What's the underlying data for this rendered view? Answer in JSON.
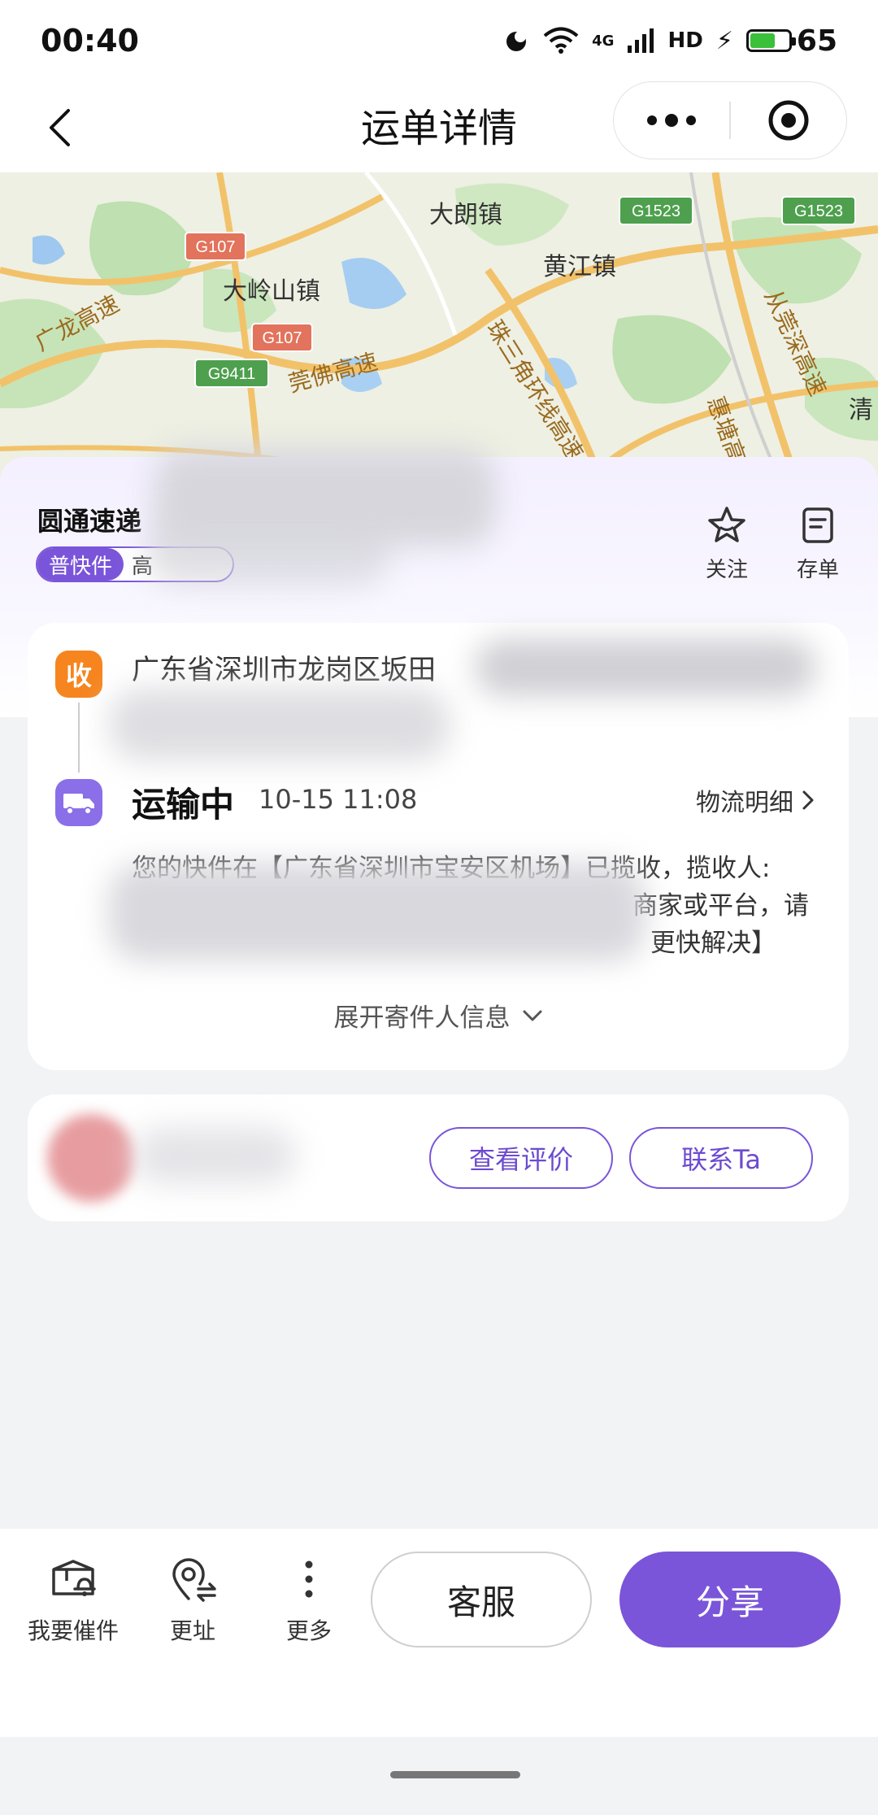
{
  "status_bar": {
    "time": "00:40",
    "network": "4G",
    "hd": "HD",
    "battery": "65"
  },
  "nav": {
    "title": "运单详情"
  },
  "map": {
    "labels": [
      "大朗镇",
      "黄江镇",
      "大岭山镇",
      "广龙高速",
      "莞佛高速",
      "珠三角环线高速",
      "从莞深高速",
      "惠塘高速",
      "清"
    ],
    "road_shields": [
      "G107",
      "G107",
      "G9411",
      "G1523",
      "G1523"
    ]
  },
  "panel": {
    "carrier": "圆通速递",
    "tag_primary": "普快件",
    "tag_secondary": "高",
    "follow_label": "关注",
    "save_label": "存单"
  },
  "card": {
    "receive_badge": "收",
    "address": "广东省深圳市龙岗区坂田",
    "status": "运输中",
    "status_time": "10-15 11:08",
    "logistics_link": "物流明细",
    "message_line1": "您的快件在【广东省深圳市宝安区机场】已揽收，揽收人:",
    "message_line2_tail": "商家或平台，请",
    "message_line3_tail": "更快解决】",
    "expand_label": "展开寄件人信息"
  },
  "courier": {
    "review_button": "查看评价",
    "contact_button": "联系Ta"
  },
  "bottom": {
    "urge_label": "我要催件",
    "change_address_label": "更址",
    "more_label": "更多",
    "service_button": "客服",
    "share_button": "分享"
  },
  "colors": {
    "accent": "#7a55d9",
    "receive": "#f6851f"
  }
}
